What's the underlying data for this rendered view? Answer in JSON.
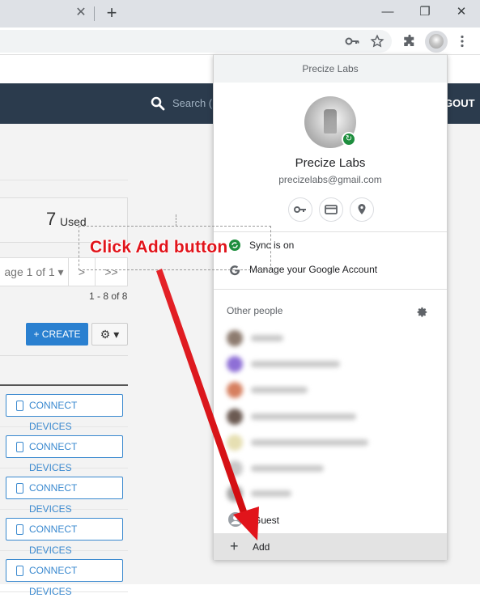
{
  "browser": {
    "tab_close_glyph": "✕",
    "new_tab_glyph": "+",
    "minimize_glyph": "—",
    "restore_glyph": "❐",
    "close_glyph": "✕"
  },
  "app": {
    "search_placeholder": "Search (",
    "nav_right_text": "GOUT",
    "used_count": "7",
    "used_label": "Used",
    "pager_label": "age 1 of 1 ▾",
    "pager_next": ">",
    "pager_last": ">>",
    "range_text": "1 - 8 of 8",
    "create_label": "+ CREATE",
    "gear_label": "⚙ ▾",
    "connect_label": "CONNECT DEVICES",
    "rows": [
      {
        "action": "CONNECT DEVICES"
      },
      {
        "action": "CONNECT DEVICES"
      },
      {
        "action": "CONNECT DEVICES"
      },
      {
        "action": "CONNECT DEVICES"
      },
      {
        "action": "CONNECT DEVICES"
      }
    ]
  },
  "profile_menu": {
    "header": "Precize Labs",
    "name": "Precize Labs",
    "email": "precizelabs@gmail.com",
    "sync_label": "Sync is on",
    "manage_label": "Manage your Google Account",
    "other_people_label": "Other people",
    "guest_label": "Guest",
    "add_label": "Add"
  },
  "annotation": {
    "text": "Click Add button",
    "color": "#e1141b"
  },
  "colors": {
    "navbar": "#2b3b4d",
    "accent_blue": "#2a80d0",
    "sync_green": "#1e8e3e"
  }
}
